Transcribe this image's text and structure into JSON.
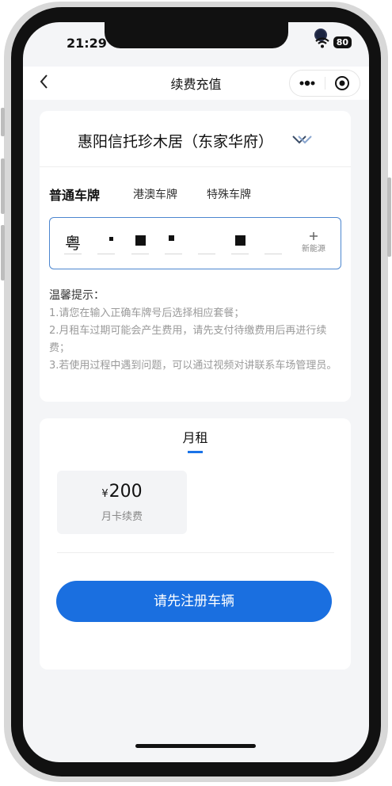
{
  "status": {
    "time": "21:29",
    "battery": "80"
  },
  "nav": {
    "title": "续费充值"
  },
  "parking": {
    "name": "惠阳信托珍木居（东家华府）"
  },
  "plate_tabs": [
    "普通车牌",
    "港澳车牌",
    "特殊车牌"
  ],
  "plate": {
    "province": "粤",
    "nev_label": "新能源"
  },
  "tips": {
    "title": "温馨提示：",
    "items": [
      "1.请您在输入正确车牌号后选择相应套餐；",
      "2.月租车过期可能会产生费用，请先支付待缴费用后再进行续费；",
      "3.若使用过程中遇到问题，可以通过视频对讲联系车场管理员。"
    ]
  },
  "plan": {
    "tab": "月租",
    "currency": "¥",
    "price": "200",
    "desc": "月卡续费"
  },
  "action": {
    "register_label": "请先注册车辆"
  },
  "colors": {
    "accent": "#1a6fe0",
    "plate_border": "#4c86cf"
  }
}
